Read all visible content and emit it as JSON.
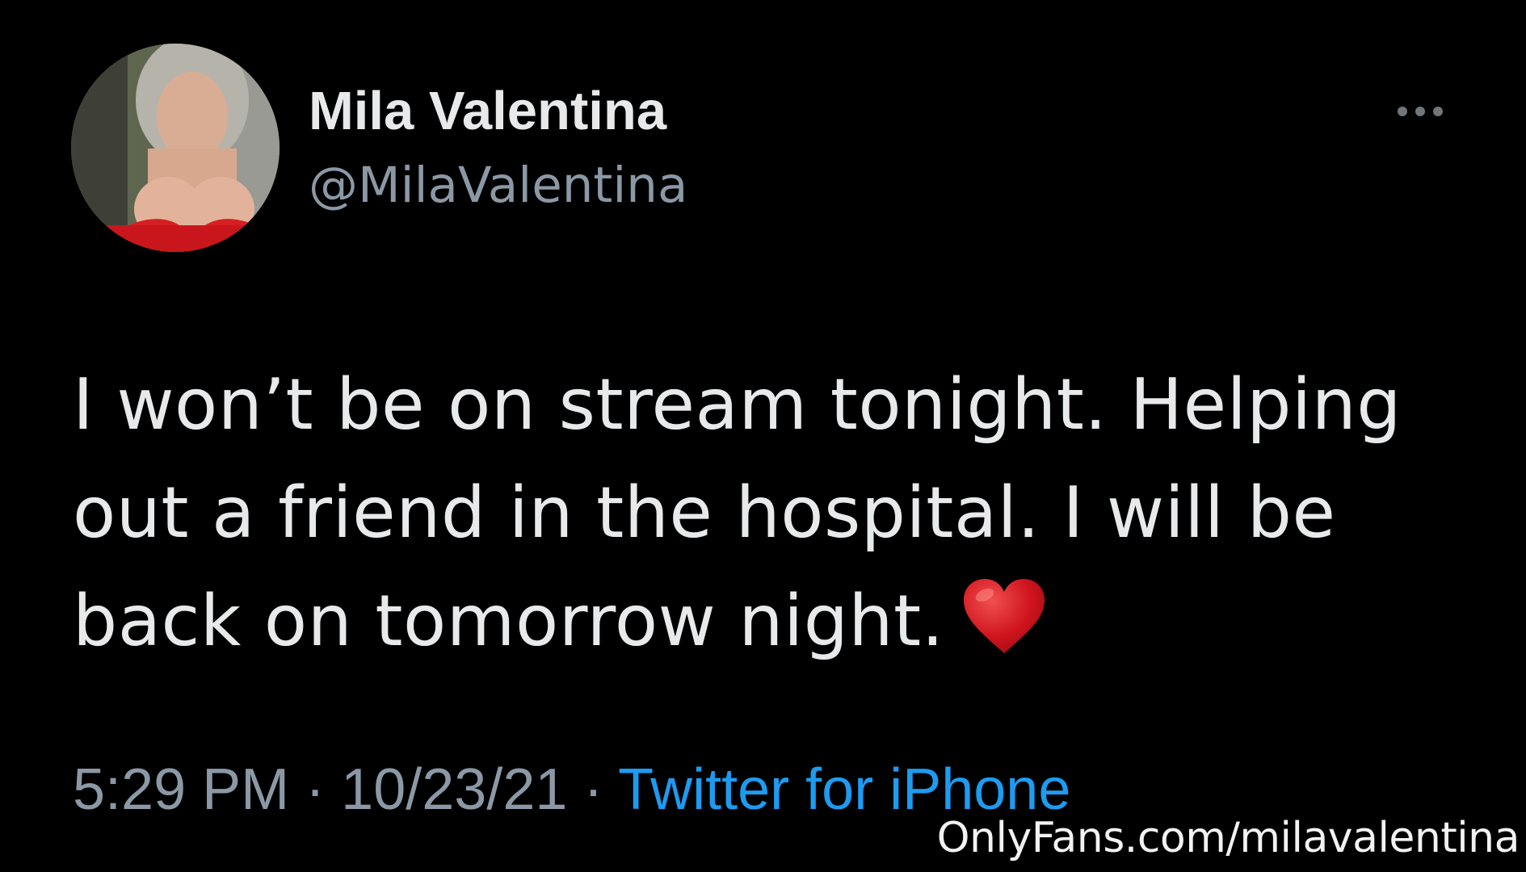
{
  "tweet": {
    "display_name": "Mila Valentina",
    "handle": "@MilaValentina",
    "text_line1": "I won’t be on stream tonight. Helping",
    "text_line2": "out a friend in the hospital. I will be",
    "text_line3": "back on tomorrow night.",
    "time": "5:29 PM",
    "separator": "·",
    "date": "10/23/21",
    "source": "Twitter for iPhone"
  },
  "icons": {
    "more": "more-horizontal-icon",
    "heart": "red-heart-emoji"
  },
  "watermark": "OnlyFans.com/milavalentina",
  "colors": {
    "background": "#000000",
    "primary_text": "#e7e9ea",
    "secondary_text": "#8b98a5",
    "link": "#1d9bf0",
    "heart": "#d0141e"
  }
}
